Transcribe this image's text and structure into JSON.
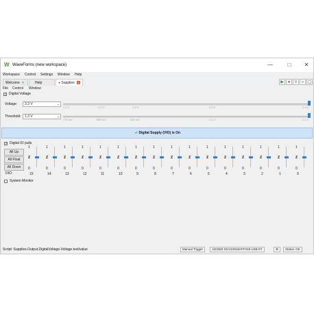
{
  "window": {
    "title": "WaveForms (new workspace)",
    "minimize": "—",
    "maximize": "□",
    "close": "✕"
  },
  "menubar": [
    "Workspace",
    "Control",
    "Settings",
    "Window",
    "Help"
  ],
  "tabs": {
    "welcome": "Welcome",
    "help": "Help",
    "supplies": "Supplies"
  },
  "submenu": [
    "File",
    "Control",
    "Window"
  ],
  "digital_voltage": {
    "label": "Digital Voltage",
    "voltage_label": "Voltage:",
    "voltage_value": "3.3 V",
    "voltage_ticks": [
      "1.2 V",
      "3.3 V",
      "1.8 V",
      "2.5 V",
      "3.3 V"
    ],
    "threshold_label": "Threshold:",
    "threshold_value": "1.3 V",
    "threshold_ticks": [
      "770 mV",
      "860 mV",
      "920 mV",
      "1.1 V",
      "1.3 V"
    ],
    "status": "Digital Supply (VIO) is On"
  },
  "dio": {
    "pulls_label": "Digital IO pulls",
    "all_up": "All Up",
    "all_float": "All Float",
    "all_down": "All Down",
    "dio_label": "DIO:",
    "top_value": "1",
    "mid_value": "Z",
    "bottom_value": "0",
    "first_top": "1",
    "ids": [
      "15",
      "14",
      "13",
      "12",
      "11",
      "10",
      "9",
      "8",
      "7",
      "6",
      "5",
      "4",
      "3",
      "2",
      "1",
      "0"
    ]
  },
  "system_monitor": "System Monitor",
  "statusbar": {
    "script": "Script: Supplies.Output.DigitalVoltage.Voltage.text/value",
    "manual_trigger": "Manual Trigger",
    "device": "AD3450 SN:210018AFF318 USB:ST",
    "status": "Status: OK"
  }
}
